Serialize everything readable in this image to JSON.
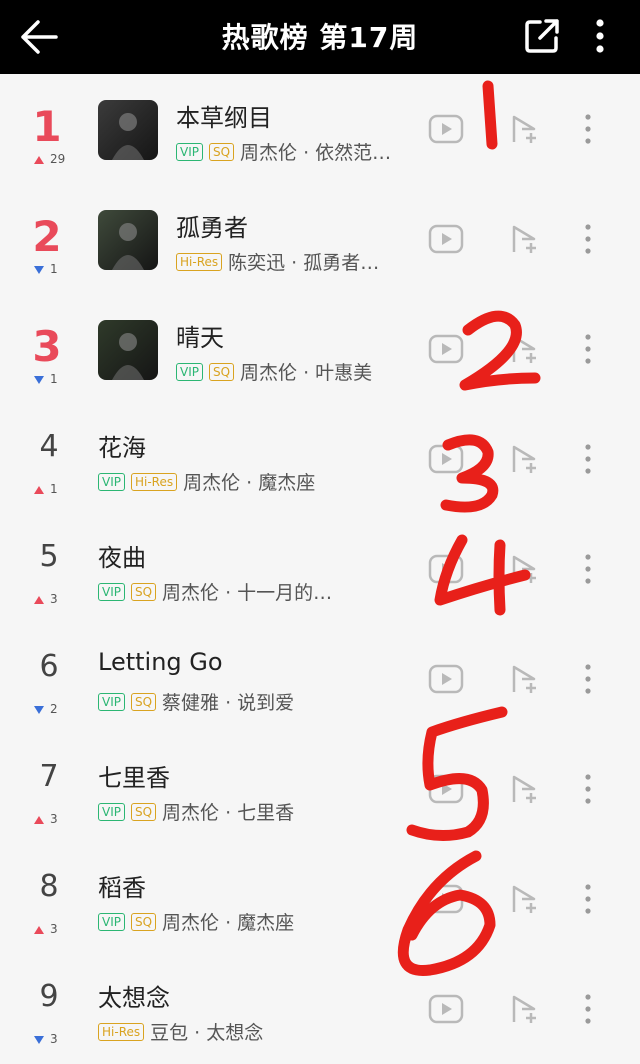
{
  "header": {
    "title": "热歌榜 第17周"
  },
  "songs": [
    {
      "rank": "1",
      "top": true,
      "trend": "up",
      "change": "29",
      "title": "本草纲目",
      "tags": [
        "VIP",
        "SQ"
      ],
      "artist": "周杰伦 · 依然范…",
      "cover": "#3b3b3b"
    },
    {
      "rank": "2",
      "top": true,
      "trend": "down",
      "change": "1",
      "title": "孤勇者",
      "tags": [
        "Hi-Res"
      ],
      "artist": "陈奕迅 · 孤勇者…",
      "cover": "#3f4a3b"
    },
    {
      "rank": "3",
      "top": true,
      "trend": "down",
      "change": "1",
      "title": "晴天",
      "tags": [
        "VIP",
        "SQ"
      ],
      "artist": "周杰伦 · 叶惠美",
      "cover": "#2f3a2a"
    },
    {
      "rank": "4",
      "top": false,
      "trend": "up",
      "change": "1",
      "title": "花海",
      "tags": [
        "VIP",
        "Hi-Res"
      ],
      "artist": "周杰伦 · 魔杰座"
    },
    {
      "rank": "5",
      "top": false,
      "trend": "up",
      "change": "3",
      "title": "夜曲",
      "tags": [
        "VIP",
        "SQ"
      ],
      "artist": "周杰伦 · 十一月的萧邦"
    },
    {
      "rank": "6",
      "top": false,
      "trend": "down",
      "change": "2",
      "title": "Letting Go",
      "tags": [
        "VIP",
        "SQ"
      ],
      "artist": "蔡健雅 · 说到爱"
    },
    {
      "rank": "7",
      "top": false,
      "trend": "up",
      "change": "3",
      "title": "七里香",
      "tags": [
        "VIP",
        "SQ"
      ],
      "artist": "周杰伦 · 七里香"
    },
    {
      "rank": "8",
      "top": false,
      "trend": "up",
      "change": "3",
      "title": "稻香",
      "tags": [
        "VIP",
        "SQ"
      ],
      "artist": "周杰伦 · 魔杰座"
    },
    {
      "rank": "9",
      "top": false,
      "trend": "down",
      "change": "3",
      "title": "太想念",
      "tags": [
        "Hi-Res"
      ],
      "artist": "豆包 · 太想念"
    }
  ],
  "annotations": [
    "1",
    "2",
    "3",
    "4",
    "5",
    "6"
  ],
  "icons": {
    "back": "back-arrow-icon",
    "share": "share-icon",
    "more": "more-vertical-icon",
    "play": "play-video-icon",
    "add": "add-to-playlist-icon",
    "row_more": "more-vertical-icon"
  },
  "colors": {
    "accent_red": "#e94a5a",
    "trend_down": "#3a6fd8",
    "vip": "#2bb673",
    "sq": "#d9a320",
    "handwriting": "#e8201a"
  }
}
